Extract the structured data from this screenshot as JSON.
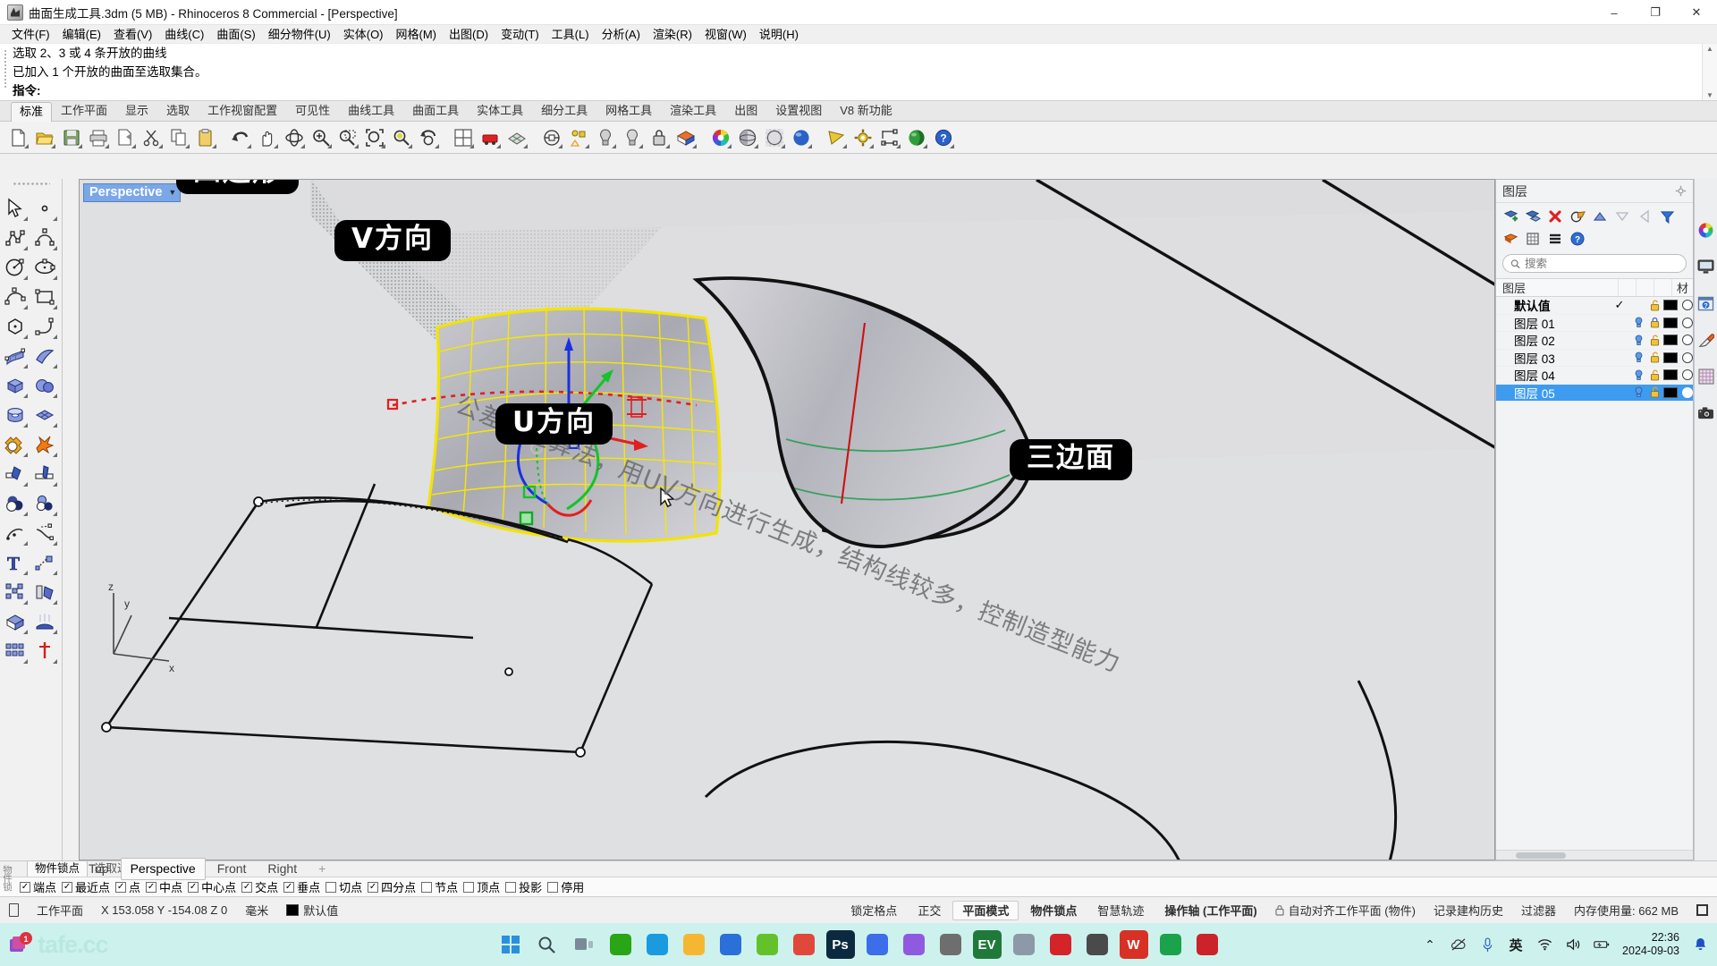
{
  "window": {
    "title": "曲面生成工具.3dm (5 MB) - Rhinoceros 8 Commercial - [Perspective]",
    "minimize": "–",
    "maximize": "❐",
    "close": "✕"
  },
  "menu": {
    "items": [
      "文件(F)",
      "编辑(E)",
      "查看(V)",
      "曲线(C)",
      "曲面(S)",
      "细分物件(U)",
      "实体(O)",
      "网格(M)",
      "出图(D)",
      "变动(T)",
      "工具(L)",
      "分析(A)",
      "渲染(R)",
      "视窗(W)",
      "说明(H)"
    ]
  },
  "command": {
    "history_1": "选取 2、3 或 4 条开放的曲线",
    "history_2": "已加入 1 个开放的曲面至选取集合。",
    "prompt": "指令:"
  },
  "toolbar_tabs": {
    "items": [
      "标准",
      "工作平面",
      "显示",
      "选取",
      "工作视窗配置",
      "可见性",
      "曲线工具",
      "曲面工具",
      "实体工具",
      "细分工具",
      "网格工具",
      "渲染工具",
      "出图",
      "设置视图",
      "V8 新功能"
    ],
    "active": "标准"
  },
  "main_toolbar": {
    "buttons": [
      {
        "name": "new-file-icon",
        "label": "新建"
      },
      {
        "name": "open-file-icon",
        "label": "开启"
      },
      {
        "name": "save-file-icon",
        "label": "储存"
      },
      {
        "name": "print-icon",
        "label": "打印"
      },
      {
        "name": "copy-to-clipboard-icon",
        "label": "复制到剪贴板"
      },
      {
        "name": "cut-icon",
        "label": "剪下"
      },
      {
        "name": "copy-icon",
        "label": "复制"
      },
      {
        "name": "paste-icon",
        "label": "贴上"
      },
      {
        "name": "undo-icon",
        "label": "复原"
      },
      {
        "name": "pan-icon",
        "label": "平移"
      },
      {
        "name": "rotate-view-icon",
        "label": "旋转视图"
      },
      {
        "name": "zoom-in-icon",
        "label": "放大"
      },
      {
        "name": "zoom-window-icon",
        "label": "框选缩放"
      },
      {
        "name": "zoom-extents-icon",
        "label": "最大化显示"
      },
      {
        "name": "zoom-selected-icon",
        "label": "缩放至选取物件"
      },
      {
        "name": "zoom-previous-icon",
        "label": "回到上一个视图"
      },
      {
        "name": "four-view-icon",
        "label": "四个视图"
      },
      {
        "name": "max-viewport-icon",
        "label": "最大化视图"
      },
      {
        "name": "render-preview-icon",
        "label": "渲染预览"
      },
      {
        "name": "grid-snap-icon",
        "label": "格点锁定"
      },
      {
        "name": "cplane-icon",
        "label": "工作平面"
      },
      {
        "name": "properties-icon",
        "label": "物件属性"
      },
      {
        "name": "light-icon",
        "label": "灯光"
      },
      {
        "name": "lock-icon",
        "label": "锁定物件"
      },
      {
        "name": "layer-icon",
        "label": "图层"
      },
      {
        "name": "color-wheel-icon",
        "label": "颜色"
      },
      {
        "name": "shaded-view-icon",
        "label": "着色模式"
      },
      {
        "name": "ghosted-view-icon",
        "label": "半透明模式"
      },
      {
        "name": "rendered-view-icon",
        "label": "渲染模式"
      },
      {
        "name": "named-view-icon",
        "label": "命名视图"
      },
      {
        "name": "options-gear-icon",
        "label": "选项"
      },
      {
        "name": "dimension-icon",
        "label": "标注"
      },
      {
        "name": "render-globe-icon",
        "label": "渲染"
      },
      {
        "name": "help-icon",
        "label": "说明"
      }
    ]
  },
  "left_toolbar": {
    "buttons": [
      {
        "name": "select-arrow-icon",
        "label": "选取物件"
      },
      {
        "name": "point-icon",
        "label": "点"
      },
      {
        "name": "polyline-icon",
        "label": "多重直线"
      },
      {
        "name": "curve-icon",
        "label": "控制点曲线"
      },
      {
        "name": "circle-icon",
        "label": "圆"
      },
      {
        "name": "ellipse-icon",
        "label": "椭圆"
      },
      {
        "name": "arc-icon",
        "label": "圆弧"
      },
      {
        "name": "rectangle-icon",
        "label": "矩形"
      },
      {
        "name": "polygon-icon",
        "label": "多边形"
      },
      {
        "name": "fillet-curve-icon",
        "label": "曲线圆角"
      },
      {
        "name": "surface-from-points-icon",
        "label": "点生成曲面"
      },
      {
        "name": "extrude-surface-icon",
        "label": "挤出曲面"
      },
      {
        "name": "box-icon",
        "label": "立方体"
      },
      {
        "name": "sphere-icon",
        "label": "球体"
      },
      {
        "name": "cylinder-icon",
        "label": "圆柱体"
      },
      {
        "name": "subd-box-icon",
        "label": "细分方块"
      },
      {
        "name": "boolean-union-icon",
        "label": "布尔联集"
      },
      {
        "name": "explode-icon",
        "label": "炸开"
      },
      {
        "name": "trim-icon",
        "label": "修剪"
      },
      {
        "name": "split-icon",
        "label": "分割"
      },
      {
        "name": "boolean-difference-icon",
        "label": "布尔差集"
      },
      {
        "name": "boolean-intersect-icon",
        "label": "布尔交集"
      },
      {
        "name": "offset-curve-icon",
        "label": "偏移曲线"
      },
      {
        "name": "blend-curve-icon",
        "label": "混接曲线"
      },
      {
        "name": "text-icon",
        "label": "文字"
      },
      {
        "name": "move-icon",
        "label": "移动"
      },
      {
        "name": "array-icon",
        "label": "阵列"
      },
      {
        "name": "mirror-icon",
        "label": "镜像"
      },
      {
        "name": "cap-icon",
        "label": "加盖"
      },
      {
        "name": "light-array-icon",
        "label": "灯光阵列"
      },
      {
        "name": "grid-block-icon",
        "label": "图块"
      },
      {
        "name": "analyze-icon",
        "label": "分析"
      }
    ]
  },
  "viewport": {
    "label": "Perspective",
    "tabs": [
      "Top",
      "Perspective",
      "Front",
      "Right"
    ],
    "active_tab": "Perspective",
    "add_tab": "+",
    "watermark": "公差逼近算法，用UV方向进行生成，结构线较多，控制造型能力",
    "callouts": [
      {
        "name": "callout-quad",
        "text": "四边形"
      },
      {
        "name": "callout-v-direction",
        "text": "V方向"
      },
      {
        "name": "callout-u-direction",
        "text": "U方向"
      },
      {
        "name": "callout-trilateral",
        "text": "三边面"
      }
    ],
    "axis_labels": {
      "x": "x",
      "y": "y",
      "z": "z"
    }
  },
  "layers_panel": {
    "title": "图层",
    "gear": "gear-icon",
    "search_placeholder": "搜索",
    "columns": {
      "name": "图层",
      "material": "材"
    },
    "tool_buttons": [
      {
        "name": "new-layer-icon"
      },
      {
        "name": "new-sublayer-icon"
      },
      {
        "name": "delete-layer-icon"
      },
      {
        "name": "layer-properties-icon"
      },
      {
        "name": "move-layer-up-icon"
      },
      {
        "name": "move-layer-down-icon"
      },
      {
        "name": "move-layer-left-icon"
      },
      {
        "name": "filter-icon"
      },
      {
        "name": "select-layer-objects-icon"
      },
      {
        "name": "layer-grid-icon"
      },
      {
        "name": "layer-list-icon"
      },
      {
        "name": "layer-help-icon"
      }
    ],
    "rows": [
      {
        "name": "默认值",
        "current": true,
        "visible": false,
        "locked": false,
        "color": "#000000",
        "selected": false,
        "bold": true
      },
      {
        "name": "图层 01",
        "current": false,
        "visible": true,
        "locked": true,
        "color": "#000000",
        "selected": false,
        "bold": false
      },
      {
        "name": "图层 02",
        "current": false,
        "visible": true,
        "locked": false,
        "color": "#000000",
        "selected": false,
        "bold": false
      },
      {
        "name": "图层 03",
        "current": false,
        "visible": true,
        "locked": false,
        "color": "#000000",
        "selected": false,
        "bold": false
      },
      {
        "name": "图层 04",
        "current": false,
        "visible": true,
        "locked": false,
        "color": "#000000",
        "selected": false,
        "bold": false
      },
      {
        "name": "图层 05",
        "current": false,
        "visible": true,
        "locked": false,
        "color": "#000000",
        "selected": true,
        "bold": false
      }
    ]
  },
  "right_rail": {
    "buttons": [
      {
        "name": "color-picker-icon"
      },
      {
        "name": "display-monitor-icon"
      },
      {
        "name": "help-panel-icon"
      },
      {
        "name": "eyedropper-icon"
      },
      {
        "name": "texture-grid-icon"
      },
      {
        "name": "camera-icon"
      }
    ]
  },
  "osnap": {
    "vertical_label": "物件锁点",
    "tabs": [
      "物件锁点",
      "选取过滤器"
    ],
    "active_tab": "物件锁点",
    "items": [
      {
        "label": "端点",
        "checked": true
      },
      {
        "label": "最近点",
        "checked": true
      },
      {
        "label": "点",
        "checked": true
      },
      {
        "label": "中点",
        "checked": true
      },
      {
        "label": "中心点",
        "checked": true
      },
      {
        "label": "交点",
        "checked": true
      },
      {
        "label": "垂点",
        "checked": true
      },
      {
        "label": "切点",
        "checked": false
      },
      {
        "label": "四分点",
        "checked": true
      },
      {
        "label": "节点",
        "checked": false
      },
      {
        "label": "顶点",
        "checked": false
      },
      {
        "label": "投影",
        "checked": false
      },
      {
        "label": "停用",
        "checked": false
      }
    ]
  },
  "statusbar": {
    "cplane": "工作平面",
    "coords": "X 153.058 Y -154.08 Z 0",
    "units": "毫米",
    "layer_color": "#000000",
    "layer": "默认值",
    "toggles": [
      {
        "label": "锁定格点",
        "on": false
      },
      {
        "label": "正交",
        "on": false
      },
      {
        "label": "平面模式",
        "on": true
      },
      {
        "label": "物件锁点",
        "on": false,
        "bold": true
      },
      {
        "label": "智慧轨迹",
        "on": false
      },
      {
        "label": "操作轴 (工作平面)",
        "on": false,
        "bold": true
      }
    ],
    "auto_cplane": "自动对齐工作平面 (物件)",
    "history": "记录建构历史",
    "filter": "过滤器",
    "memory": "内存使用量: 662 MB"
  },
  "taskbar": {
    "watermark": "tafe.cc",
    "apps": [
      {
        "name": "start-windows-icon",
        "label": "",
        "color": "#2b8fe0"
      },
      {
        "name": "search-icon",
        "label": "",
        "color": "#4a5a66"
      },
      {
        "name": "task-view-icon",
        "label": "",
        "color": "#5a6a77"
      },
      {
        "name": "app-wechat-icon",
        "label": "",
        "color": "#2aa515"
      },
      {
        "name": "app-edge-icon",
        "label": "",
        "color": "#1a9be0"
      },
      {
        "name": "app-explorer-icon",
        "label": "",
        "color": "#f5b731"
      },
      {
        "name": "app-browser-icon",
        "label": "",
        "color": "#2b6fd8"
      },
      {
        "name": "app-note-icon",
        "label": "",
        "color": "#63c22c"
      },
      {
        "name": "app-shuffle-icon",
        "label": "",
        "color": "#e0483c"
      },
      {
        "name": "app-photoshop-icon",
        "label": "Ps",
        "color": "#0b2a3f"
      },
      {
        "name": "app-player-icon",
        "label": "",
        "color": "#3b6ee8"
      },
      {
        "name": "app-chat-icon",
        "label": "",
        "color": "#8f5ae0"
      },
      {
        "name": "app-rhino-icon",
        "label": "",
        "color": "#6e6e6e"
      },
      {
        "name": "app-ev-icon",
        "label": "EV",
        "color": "#1f7a3a"
      },
      {
        "name": "app-capture-icon",
        "label": "",
        "color": "#8d99a6"
      },
      {
        "name": "app-opera-icon",
        "label": "",
        "color": "#d4242a"
      },
      {
        "name": "app-rhino2-icon",
        "label": "",
        "color": "#4a4a4a"
      },
      {
        "name": "app-wps-icon",
        "label": "W",
        "color": "#d93025"
      },
      {
        "name": "app-notepad-icon",
        "label": "",
        "color": "#1aa34a"
      },
      {
        "name": "app-redapp-icon",
        "label": "",
        "color": "#cc2229"
      }
    ],
    "tray": {
      "chevron": "⌃",
      "icons": [
        "cloud-off-icon",
        "microphone-icon",
        "ime-english-icon",
        "wifi-icon",
        "volume-icon",
        "battery-icon"
      ],
      "ime_label": "英",
      "time": "22:36",
      "date": "2024-09-03",
      "notification": "bell-icon"
    }
  }
}
